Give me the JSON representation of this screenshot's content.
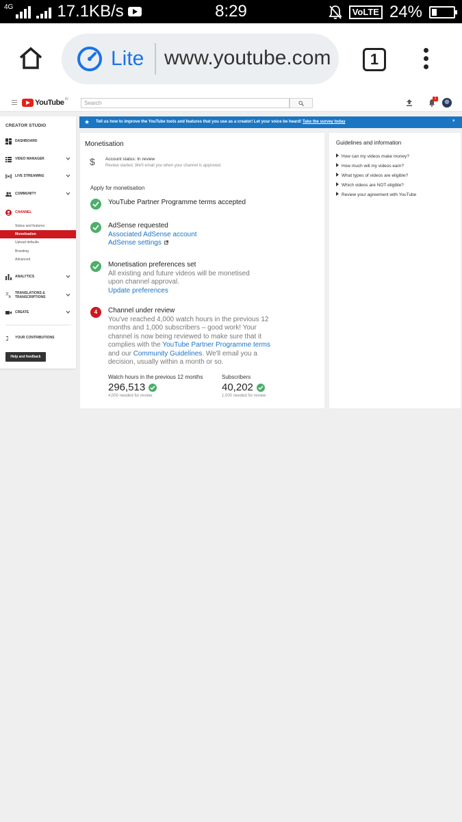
{
  "status_bar": {
    "network": "4G",
    "speed": "17.1KB/s",
    "time": "8:29",
    "volte": "VoLTE",
    "battery": "24%",
    "battery_level": 0.24
  },
  "browser": {
    "mode_label": "Lite",
    "url": "www.youtube.com",
    "tab_count": "1",
    "accent_color": "#1a73e8"
  },
  "yt_header": {
    "logo_text": "YouTube",
    "country_code": "IN",
    "search_placeholder": "Search",
    "notification_count": "1"
  },
  "sidebar": {
    "title": "CREATOR STUDIO",
    "items": [
      {
        "label": "DASHBOARD",
        "icon": "dashboard-icon"
      },
      {
        "label": "VIDEO MANAGER",
        "icon": "video-manager-icon"
      },
      {
        "label": "LIVE STREAMING",
        "icon": "live-streaming-icon"
      },
      {
        "label": "COMMUNITY",
        "icon": "community-icon"
      },
      {
        "label": "CHANNEL",
        "icon": "channel-icon"
      },
      {
        "label": "ANALYTICS",
        "icon": "analytics-icon"
      },
      {
        "label": "TRANSLATIONS & TRANSCRIPTIONS",
        "icon": "translate-icon"
      },
      {
        "label": "CREATE",
        "icon": "create-icon"
      },
      {
        "label": "YOUR CONTRIBUTIONS",
        "icon": "contributions-icon"
      }
    ],
    "channel_sub": [
      "Status and features",
      "Monetisation",
      "Upload defaults",
      "Branding",
      "Advanced"
    ],
    "help_label": "Help and feedback"
  },
  "banner": {
    "text": "Tell us how to improve the YouTube tools and features that you use as a creator! Let your voice be heard!",
    "link": "Take the survey today",
    "close": "×"
  },
  "main": {
    "title": "Monetisation",
    "account_status": "Account status: In review",
    "account_sub": "Review started. We'll email you when your channel is approved.",
    "apply_title": "Apply for monetisation",
    "steps": [
      {
        "head": "YouTube Partner Programme terms accepted"
      },
      {
        "head": "AdSense requested",
        "link1": "Associated AdSense account",
        "link2": "AdSense settings"
      },
      {
        "head": "Monetisation preferences set",
        "desc": "All existing and future videos will be monetised upon channel approval.",
        "link1": "Update preferences"
      },
      {
        "number": "4",
        "head": "Channel under review",
        "desc1": "You've reached 4,000 watch hours in the previous 12 months and 1,000 subscribers – good work! Your channel is now being reviewed to make sure that it complies with the",
        "link1": "YouTube Partner Programme terms",
        "desc2": "and our",
        "link2": "Community Guidelines",
        "desc3": ". We'll email you a decision, usually within a month or so."
      }
    ],
    "stats": [
      {
        "label": "Watch hours in the previous 12 months",
        "value": "296,513",
        "note": "4,000 needed for review"
      },
      {
        "label": "Subscribers",
        "value": "40,202",
        "note": "1,000 needed for review"
      }
    ]
  },
  "guidelines": {
    "title": "Guidelines and information",
    "items": [
      "How can my videos make money?",
      "How much will my videos earn?",
      "What types of videos are eligible?",
      "Which videos are NOT eligible?",
      "Review your agreement with YouTube"
    ]
  },
  "colors": {
    "youtube_red": "#cc181e",
    "success_green": "#4caf6a",
    "link_blue": "#1a73c8",
    "banner_blue": "#1a75c2"
  }
}
